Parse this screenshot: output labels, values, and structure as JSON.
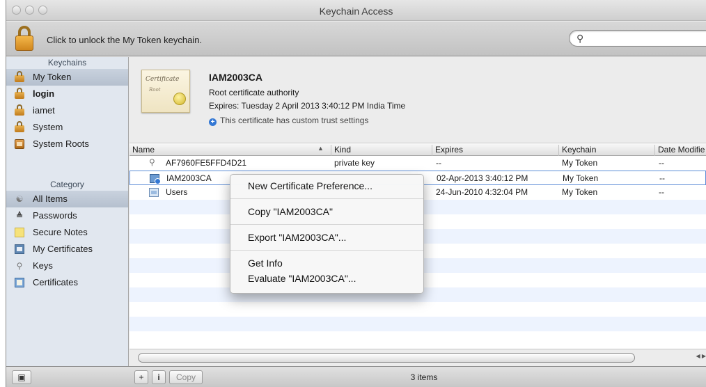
{
  "window": {
    "title": "Keychain Access",
    "lock_message": "Click to unlock the My Token keychain.",
    "search_placeholder": "",
    "search_value": ""
  },
  "sidebar": {
    "keychains_header": "Keychains",
    "keychains": [
      {
        "label": "My Token",
        "icon": "lock-icon",
        "selected": true,
        "bold": false
      },
      {
        "label": "login",
        "icon": "unlocked-icon",
        "selected": false,
        "bold": true
      },
      {
        "label": "iamet",
        "icon": "lock-icon",
        "selected": false,
        "bold": false
      },
      {
        "label": "System",
        "icon": "lock-icon",
        "selected": false,
        "bold": false
      },
      {
        "label": "System Roots",
        "icon": "cabinet-icon",
        "selected": false,
        "bold": false
      }
    ],
    "category_header": "Category",
    "categories": [
      {
        "label": "All Items",
        "icon": "people-icon",
        "selected": true
      },
      {
        "label": "Passwords",
        "icon": "pen-icon",
        "selected": false
      },
      {
        "label": "Secure Notes",
        "icon": "note-icon",
        "selected": false
      },
      {
        "label": "My Certificates",
        "icon": "certificate-icon",
        "selected": false
      },
      {
        "label": "Keys",
        "icon": "key-icon",
        "selected": false
      },
      {
        "label": "Certificates",
        "icon": "certificates-icon",
        "selected": false
      }
    ]
  },
  "certificate": {
    "image_text": "Certificate",
    "image_subtext": "Root",
    "name": "IAM2003CA",
    "type": "Root certificate authority",
    "expires": "Expires: Tuesday 2 April 2013 3:40:12 PM India Time",
    "trust_note": "This certificate has custom trust settings"
  },
  "table": {
    "columns": [
      "Name",
      "Kind",
      "Expires",
      "Keychain",
      "Date Modifie"
    ],
    "sort_column": "Kind",
    "rows": [
      {
        "name": "AF7960FE5FFD4D21",
        "kind": "private key",
        "expires": "--",
        "keychain": "My Token",
        "modified": "--",
        "icon": "key-icon"
      },
      {
        "name": "IAM2003CA",
        "kind": "",
        "expires": "02-Apr-2013 3:40:12 PM",
        "keychain": "My Token",
        "modified": "--",
        "icon": "certificate-icon",
        "selected": true
      },
      {
        "name": "Users",
        "kind": "",
        "expires": "24-Jun-2010 4:32:04 PM",
        "keychain": "My Token",
        "modified": "--",
        "icon": "users-certificate-icon"
      }
    ]
  },
  "context_menu": {
    "items": [
      "New Certificate Preference...",
      "Copy \"IAM2003CA\"",
      "Export \"IAM2003CA\"...",
      "Get Info",
      "Evaluate \"IAM2003CA\"..."
    ]
  },
  "bottom_bar": {
    "add_label": "+",
    "info_label": "i",
    "copy_label": "Copy",
    "status": "3 items"
  }
}
